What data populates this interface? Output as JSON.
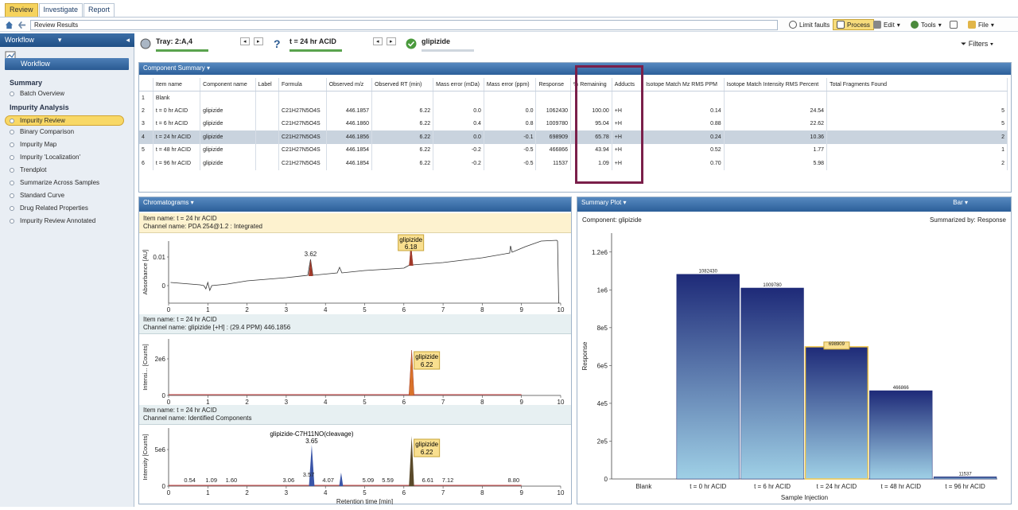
{
  "tabs": [
    "Review",
    "Investigate",
    "Report"
  ],
  "breadcrumb": "Review Results",
  "toolbar": {
    "limit_faults": "Limit faults",
    "process": "Process",
    "edit": "Edit",
    "tools": "Tools",
    "file": "File",
    "filters": "Filters"
  },
  "sidebar": {
    "title": "Workflow",
    "workflow_btn": "Workflow",
    "summary_title": "Summary",
    "summary_items": [
      "Batch Overview"
    ],
    "impurity_title": "Impurity Analysis",
    "impurity_items": [
      "Impurity Review",
      "Binary Comparison",
      "Impurity Map",
      "Impurity 'Localization'",
      "Trendplot",
      "Summarize Across Samples",
      "Standard Curve",
      "Drug Related Properties",
      "Impurity Review Annotated"
    ],
    "active_index": 0
  },
  "status": {
    "tray": "Tray: 2:A,4",
    "injection": "t = 24 hr ACID",
    "component": "glipizide"
  },
  "component_summary": {
    "title": "Component Summary",
    "columns": [
      "Item name",
      "Component name",
      "Label",
      "Formula",
      "Observed m/z",
      "Observed RT (min)",
      "Mass error (mDa)",
      "Mass error (ppm)",
      "Response",
      "% Remaining",
      "Adducts",
      "Isotope Match Mz RMS PPM",
      "Isotope Match Intensity RMS Percent",
      "Total Fragments Found"
    ],
    "rows": [
      [
        "1",
        "Blank",
        "",
        "",
        "",
        "",
        "",
        "",
        "",
        "",
        "",
        "",
        "",
        "",
        ""
      ],
      [
        "2",
        "t = 0 hr ACID",
        "glipizide",
        "",
        "C21H27N5O4S",
        "446.1857",
        "6.22",
        "0.0",
        "0.0",
        "1062430",
        "100.00",
        "+H",
        "0.14",
        "24.54",
        "5"
      ],
      [
        "3",
        "t = 6 hr ACID",
        "glipizide",
        "",
        "C21H27N5O4S",
        "446.1860",
        "6.22",
        "0.4",
        "0.8",
        "1009780",
        "95.04",
        "+H",
        "0.88",
        "22.62",
        "5"
      ],
      [
        "4",
        "t = 24 hr ACID",
        "glipizide",
        "",
        "C21H27N5O4S",
        "446.1856",
        "6.22",
        "0.0",
        "-0.1",
        "698909",
        "65.78",
        "+H",
        "0.24",
        "10.36",
        "2"
      ],
      [
        "5",
        "t = 48 hr ACID",
        "glipizide",
        "",
        "C21H27N5O4S",
        "446.1854",
        "6.22",
        "-0.2",
        "-0.5",
        "466866",
        "43.94",
        "+H",
        "0.52",
        "1.77",
        "1"
      ],
      [
        "6",
        "t = 96 hr ACID",
        "glipizide",
        "",
        "C21H27N5O4S",
        "446.1854",
        "6.22",
        "-0.2",
        "-0.5",
        "11537",
        "1.09",
        "+H",
        "0.70",
        "5.98",
        "2"
      ]
    ],
    "selected_row": 3
  },
  "chromatograms": {
    "title": "Chromatograms",
    "c1": {
      "item": "Item name: t = 24 hr ACID",
      "channel": "Channel name: PDA 254@1.2 : Integrated",
      "ylabel": "Absorbance [AU]",
      "yticks": [
        "0.01",
        "0"
      ],
      "peak_labels": [
        "3.62"
      ],
      "callout": [
        "glipizide",
        "6.18"
      ]
    },
    "c2": {
      "item": "Item name: t = 24 hr ACID",
      "channel": "Channel name: glipizide [+H] : (29.4 PPM) 446.1856",
      "ylabel": "Intensi... [Counts]",
      "yticks": [
        "2e6",
        "0"
      ],
      "callout": [
        "glipizide",
        "6.22"
      ]
    },
    "c3": {
      "item": "Item name: t = 24 hr ACID",
      "channel": "Channel name: Identified Components",
      "ylabel": "Intensity [Counts]",
      "yticks": [
        "5e6",
        "0"
      ],
      "peak_labels": [
        "0.54",
        "1.09",
        "1.60",
        "3.06",
        "3.57",
        "4.07",
        "5.09",
        "5.59",
        "6.61",
        "7.12",
        "8.80"
      ],
      "cleavage": [
        "glipizide-C7H11NO(cleavage)",
        "3.65"
      ],
      "callout": [
        "glipizide",
        "6.22"
      ]
    },
    "xticks": [
      "0",
      "1",
      "2",
      "3",
      "4",
      "5",
      "6",
      "7",
      "8",
      "9",
      "10"
    ],
    "xlabel": "Retention time [min]"
  },
  "summary_plot": {
    "title": "Summary Plot",
    "bar_label": "Bar",
    "component": "Component: glipizide",
    "summarized_by": "Summarized by: Response"
  },
  "chart_data": {
    "type": "bar",
    "categories": [
      "Blank",
      "t = 0 hr ACID",
      "t = 6 hr ACID",
      "t = 24 hr ACID",
      "t = 48 hr ACID",
      "t = 96 hr ACID"
    ],
    "values": [
      0,
      1082430,
      1009780,
      698909,
      466866,
      11537
    ],
    "ylabel": "Response",
    "xlabel": "Sample Injection",
    "yticks": [
      "0",
      "2e5",
      "4e5",
      "6e5",
      "8e5",
      "1e6",
      "1.2e6"
    ],
    "ylim": [
      0,
      1300000
    ],
    "highlight_index": 3,
    "colors": {
      "dark": "#1e2a78",
      "light": "#9fd0e6",
      "highlight": "#f2c84b"
    }
  }
}
